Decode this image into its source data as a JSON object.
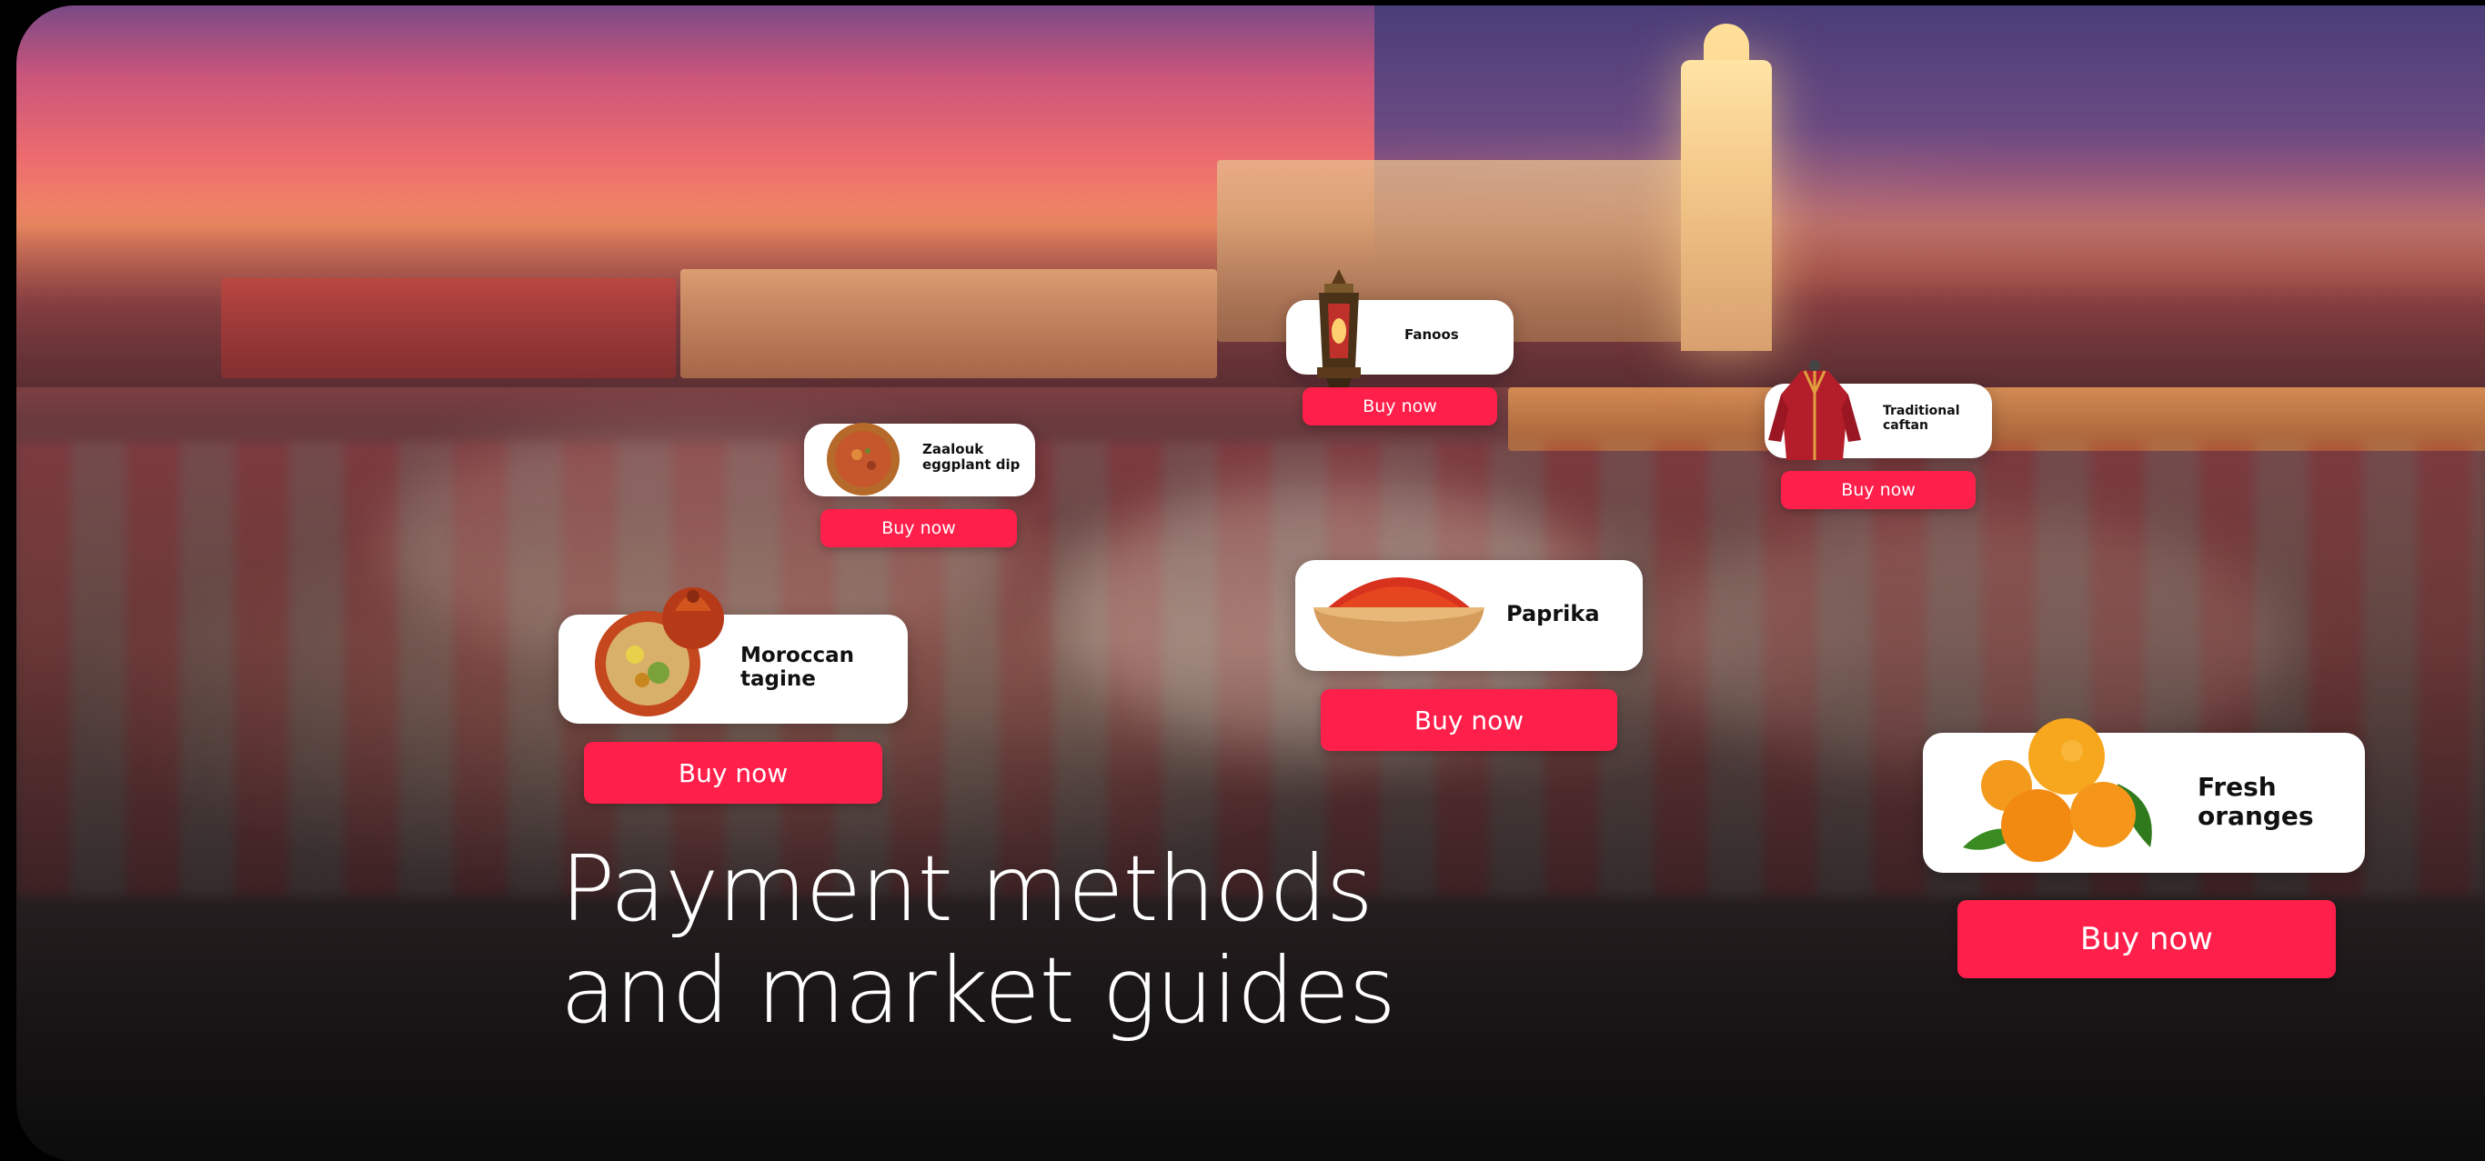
{
  "hero": {
    "headline_line1": "Payment methods",
    "headline_line2": "and market guides"
  },
  "colors": {
    "buy_button": "#ff1f4b",
    "card_background": "#ffffff",
    "headline_text": "#ffffff"
  },
  "products": [
    {
      "id": "fanoos",
      "name": "Fanoos",
      "icon": "lantern-icon",
      "button": "Buy now"
    },
    {
      "id": "zaalouk",
      "name": "Zaalouk eggplant dip",
      "icon": "dip-bowl-icon",
      "button": "Buy now"
    },
    {
      "id": "caftan",
      "name": "Traditional caftan",
      "icon": "caftan-icon",
      "button": "Buy now"
    },
    {
      "id": "paprika",
      "name": "Paprika",
      "icon": "spice-bowl-icon",
      "button": "Buy now"
    },
    {
      "id": "tagine",
      "name": "Moroccan tagine",
      "icon": "tagine-icon",
      "button": "Buy now"
    },
    {
      "id": "oranges",
      "name": "Fresh oranges",
      "icon": "oranges-icon",
      "button": "Buy now"
    }
  ]
}
